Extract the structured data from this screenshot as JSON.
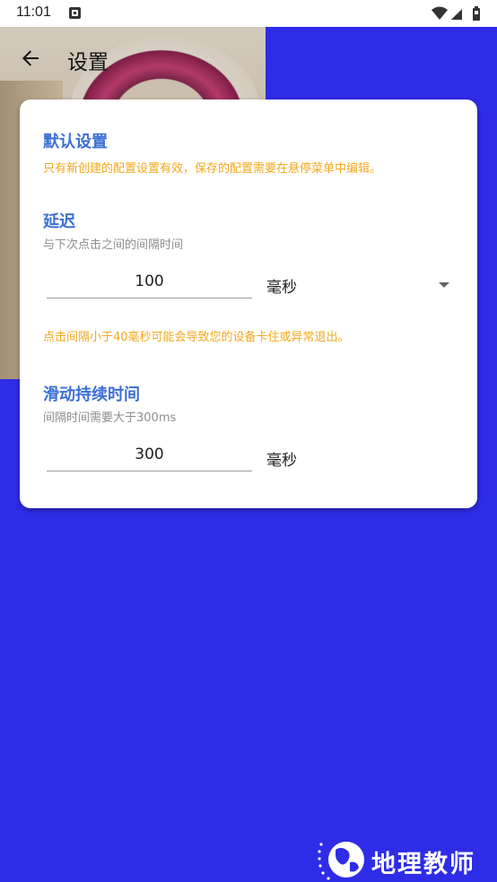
{
  "status_bar": {
    "time": "11:01",
    "icons": [
      "app-notification-icon",
      "wifi-icon",
      "signal-icon",
      "battery-icon"
    ]
  },
  "toolbar": {
    "title": "设置",
    "back_icon": "arrow-left-icon"
  },
  "default_settings": {
    "title": "默认设置",
    "note": "只有新创建的配置设置有效，保存的配置需要在悬停菜单中编辑。"
  },
  "delay": {
    "title": "延迟",
    "description": "与下次点击之间的间隔时间",
    "value": "100",
    "unit": "毫秒",
    "warning": "点击间隔小于40毫秒可能会导致您的设备卡住或异常退出。"
  },
  "swipe_duration": {
    "title": "滑动持续时间",
    "description": "间隔时间需要大于300ms",
    "value": "300",
    "unit": "毫秒"
  },
  "watermark": {
    "text": "地理教师"
  },
  "colors": {
    "background": "#2e2ce6",
    "accent_title": "#3b6fd6",
    "warning": "#f3a81c"
  }
}
